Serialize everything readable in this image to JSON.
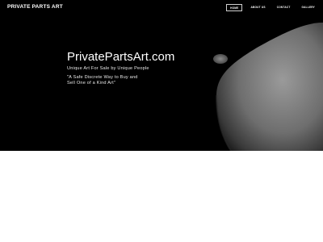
{
  "site": {
    "brand": "PRIVATE PARTS ART",
    "nav": [
      "HOME",
      "ABOUT US",
      "CONTACT",
      "GALLERY"
    ],
    "active_nav": "HOME"
  },
  "hero": {
    "title": "PrivatePartsArt.com",
    "tagline": "Unique Art For Sale by Unique People",
    "quote": "\"A Safe Discrete Way to Buy and Sell One of a Kind Art\"",
    "image": "grayscale-photo-sculpture"
  },
  "colors": {
    "hero_bg": "#000000",
    "text": "#ffffff",
    "page_bg": "#ffffff"
  }
}
